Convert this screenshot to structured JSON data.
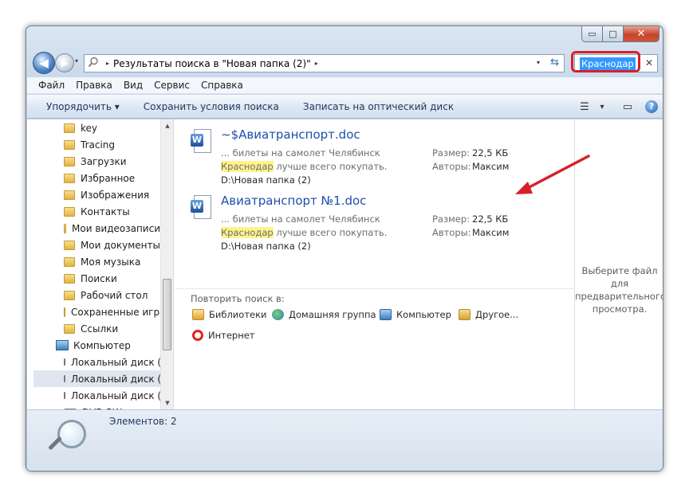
{
  "window": {
    "caption": {
      "minimize": "▭",
      "maximize": "□",
      "close": "✕"
    }
  },
  "navigation": {
    "back_glyph": "◀",
    "forward_glyph": "▶",
    "history_glyph": "▾",
    "address": {
      "segment": "Результаты поиска в \"Новая папка (2)\"",
      "separator": "▸",
      "dropdown_glyph": "▾",
      "refresh_glyph": "⇆"
    },
    "search": {
      "value": "Краснодар",
      "clear_glyph": "✕"
    }
  },
  "menu": [
    "Файл",
    "Правка",
    "Вид",
    "Сервис",
    "Справка"
  ],
  "toolbar": {
    "items": [
      "Упорядочить ▾",
      "Сохранить условия поиска",
      "Записать на оптический диск"
    ],
    "view_glyph": "☰",
    "view_drop": "▾",
    "preview_glyph": "▭",
    "help_glyph": "?"
  },
  "nav_tree": [
    {
      "label": "key",
      "type": "folder"
    },
    {
      "label": "Tracing",
      "type": "folder"
    },
    {
      "label": "Загрузки",
      "type": "folder"
    },
    {
      "label": "Избранное",
      "type": "folder"
    },
    {
      "label": "Изображения",
      "type": "folder"
    },
    {
      "label": "Контакты",
      "type": "folder"
    },
    {
      "label": "Мои видеозаписи",
      "type": "folder"
    },
    {
      "label": "Мои документы",
      "type": "folder"
    },
    {
      "label": "Моя музыка",
      "type": "folder"
    },
    {
      "label": "Поиски",
      "type": "folder"
    },
    {
      "label": "Рабочий стол",
      "type": "folder"
    },
    {
      "label": "Сохраненные игры",
      "type": "folder"
    },
    {
      "label": "Ссылки",
      "type": "folder"
    },
    {
      "label": "Компьютер",
      "type": "computer"
    },
    {
      "label": "Локальный диск (C:)",
      "type": "drive"
    },
    {
      "label": "Локальный диск (D:)",
      "type": "drive",
      "selected": true
    },
    {
      "label": "Локальный диск (E:)",
      "type": "drive"
    },
    {
      "label": "DVD RW",
      "type": "drive"
    }
  ],
  "scrollbar": {
    "up": "▲",
    "down": "▼"
  },
  "results": [
    {
      "title": "~$Авиатранспорт.doc",
      "snippet_before": "... билеты на самолет Челябинск ",
      "snippet_highlight": "Краснодар",
      "snippet_after": " лучше всего покупать.",
      "path": "D:\\Новая папка (2)",
      "size_label": "Размер:",
      "size_value": "22,5 КБ",
      "authors_label": "Авторы:",
      "authors_value": "Максим",
      "icon_letter": "W"
    },
    {
      "title": "Авиатранспорт №1.doc",
      "snippet_before": "... билеты на самолет Челябинск ",
      "snippet_highlight": "Краснодар",
      "snippet_after": " лучше всего покупать.",
      "path": "D:\\Новая папка (2)",
      "size_label": "Размер:",
      "size_value": "22,5 КБ",
      "authors_label": "Авторы:",
      "authors_value": "Максим",
      "icon_letter": "W"
    }
  ],
  "repeat_search": {
    "label": "Повторить поиск в:",
    "options": [
      "Библиотеки",
      "Домашняя группа",
      "Компьютер",
      "Другое...",
      "Интернет"
    ]
  },
  "preview": {
    "message": "Выберите файл для предварительного просмотра."
  },
  "status": {
    "items_text": "Элементов: 2"
  },
  "annotation": {
    "color": "#d6202a"
  }
}
